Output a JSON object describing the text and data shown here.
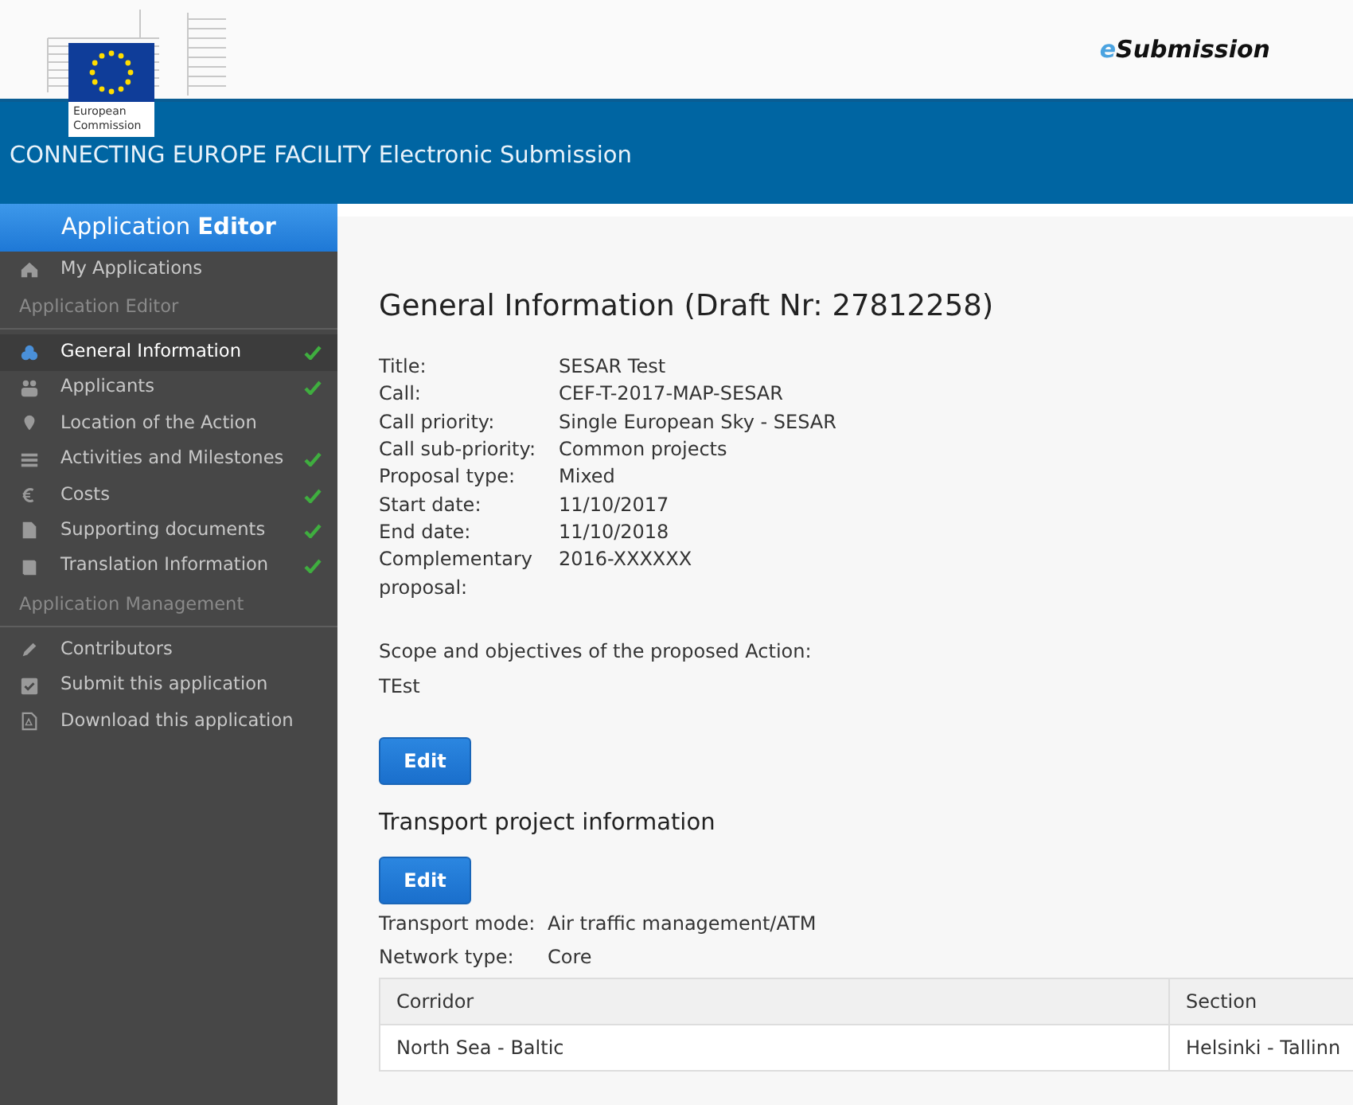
{
  "header": {
    "logo_lines": [
      "European",
      "Commission"
    ],
    "brand": {
      "prefix": "e",
      "rest": "Submission"
    },
    "title": "CONNECTING EUROPE FACILITY Electronic Submission"
  },
  "sidebar": {
    "title": "Application **Editor**",
    "items": [
      {
        "kind": "link",
        "label": "My Applications",
        "selected": false,
        "checked": false
      },
      {
        "kind": "section",
        "label": "Application Editor"
      },
      {
        "kind": "link",
        "label": "General Information",
        "selected": true,
        "checked": true
      },
      {
        "kind": "link",
        "label": "Applicants",
        "selected": false,
        "checked": true
      },
      {
        "kind": "link",
        "label": "Location of the Action",
        "selected": false,
        "checked": false
      },
      {
        "kind": "link",
        "label": "Activities and Milestones",
        "selected": false,
        "checked": true
      },
      {
        "kind": "link",
        "label": "Costs",
        "selected": false,
        "checked": true
      },
      {
        "kind": "link",
        "label": "Supporting documents",
        "selected": false,
        "checked": true
      },
      {
        "kind": "link",
        "label": "Translation Information",
        "selected": false,
        "checked": true
      },
      {
        "kind": "section",
        "label": "Application Management"
      },
      {
        "kind": "link",
        "label": "Contributors",
        "selected": false,
        "checked": false
      },
      {
        "kind": "link",
        "label": "Submit this application",
        "selected": false,
        "checked": false
      },
      {
        "kind": "link",
        "label": "Download this application",
        "selected": false,
        "checked": false
      }
    ]
  },
  "general": {
    "heading": "General Information (Draft Nr: 27812258)",
    "fields": [
      {
        "label": "Title:",
        "value": "SESAR Test"
      },
      {
        "label": "Call:",
        "value": "CEF-T-2017-MAP-SESAR"
      },
      {
        "label": "Call priority:",
        "value": "Single European Sky - SESAR"
      },
      {
        "label": "Call sub-priority:",
        "value": "Common projects"
      },
      {
        "label": "Proposal type:",
        "value": "Mixed"
      },
      {
        "label": "Start date:",
        "value": "11/10/2017"
      },
      {
        "label": "End date:",
        "value": "11/10/2018"
      },
      {
        "label": "Complementary proposal:",
        "value": "2016-XXXXXX"
      }
    ],
    "scope_label": "Scope and objectives of the proposed Action:",
    "scope_value": "TEst",
    "button": "Edit"
  },
  "transport": {
    "heading": "Transport project information",
    "button": "Edit",
    "fields": [
      {
        "label": "Transport mode:",
        "value": "Air traffic management/ATM"
      },
      {
        "label": "Network type:",
        "value": "Core"
      }
    ],
    "table": {
      "columns": [
        "Corridor",
        "Section"
      ],
      "rows": [
        [
          "North Sea - Baltic",
          "Helsinki - Tallinn"
        ]
      ]
    }
  }
}
